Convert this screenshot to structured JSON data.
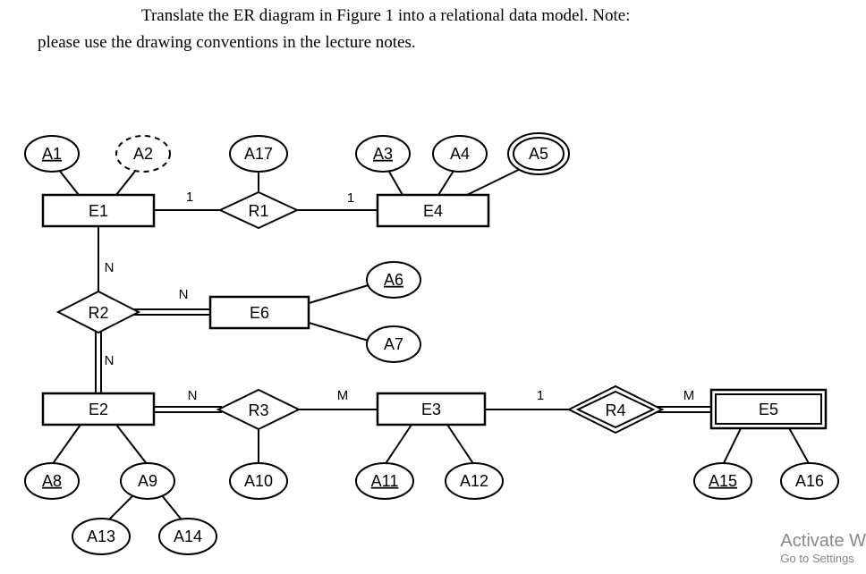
{
  "instruction": {
    "line1": "Translate the ER diagram in Figure 1 into a relational data model. Note:",
    "line2": "please use the drawing conventions in the lecture notes."
  },
  "chart_data": {
    "type": "er-diagram",
    "entities": [
      {
        "name": "E1",
        "attributes": [
          {
            "name": "A1",
            "key": true
          },
          {
            "name": "A2",
            "derived": true
          }
        ],
        "weak": false
      },
      {
        "name": "E4",
        "attributes": [
          {
            "name": "A3",
            "key": true
          },
          {
            "name": "A4"
          },
          {
            "name": "A5",
            "multivalued": true
          }
        ],
        "weak": false
      },
      {
        "name": "E6",
        "attributes": [
          {
            "name": "A6",
            "key": true
          },
          {
            "name": "A7"
          }
        ],
        "weak": false
      },
      {
        "name": "E2",
        "attributes": [
          {
            "name": "A8",
            "key": true
          },
          {
            "name": "A9",
            "composite": [
              "A13",
              "A14"
            ]
          }
        ],
        "weak": false
      },
      {
        "name": "E3",
        "attributes": [
          {
            "name": "A11",
            "key": true
          },
          {
            "name": "A12"
          }
        ],
        "weak": false
      },
      {
        "name": "E5",
        "attributes": [
          {
            "name": "A15",
            "partial_key": true
          },
          {
            "name": "A16"
          }
        ],
        "weak": true
      }
    ],
    "relationships": [
      {
        "name": "R1",
        "attributes": [
          {
            "name": "A17"
          }
        ],
        "links": [
          {
            "entity": "E1",
            "card": "1"
          },
          {
            "entity": "E4",
            "card": "1"
          }
        ]
      },
      {
        "name": "R2",
        "attributes": [],
        "links": [
          {
            "entity": "E1",
            "card": "N"
          },
          {
            "entity": "E6",
            "card": "N",
            "total": true
          },
          {
            "entity": "E2",
            "card": "N",
            "total": true
          }
        ]
      },
      {
        "name": "R3",
        "attributes": [
          {
            "name": "A10"
          }
        ],
        "links": [
          {
            "entity": "E2",
            "card": "N",
            "total": true
          },
          {
            "entity": "E3",
            "card": "M"
          }
        ]
      },
      {
        "name": "R4",
        "identifying": true,
        "attributes": [],
        "links": [
          {
            "entity": "E3",
            "card": "1"
          },
          {
            "entity": "E5",
            "card": "M",
            "total": true
          }
        ]
      }
    ]
  },
  "labels": {
    "E1": "E1",
    "E2": "E2",
    "E3": "E3",
    "E4": "E4",
    "E5": "E5",
    "E6": "E6",
    "R1": "R1",
    "R2": "R2",
    "R3": "R3",
    "R4": "R4",
    "A1": "A1",
    "A2": "A2",
    "A3": "A3",
    "A4": "A4",
    "A5": "A5",
    "A6": "A6",
    "A7": "A7",
    "A8": "A8",
    "A9": "A9",
    "A10": "A10",
    "A11": "A11",
    "A12": "A12",
    "A13": "A13",
    "A14": "A14",
    "A15": "A15",
    "A16": "A16",
    "A17": "A17",
    "c1": "1",
    "cN": "N",
    "cM": "M"
  },
  "watermark": {
    "title": "Activate W",
    "sub": "Go to Settings"
  }
}
